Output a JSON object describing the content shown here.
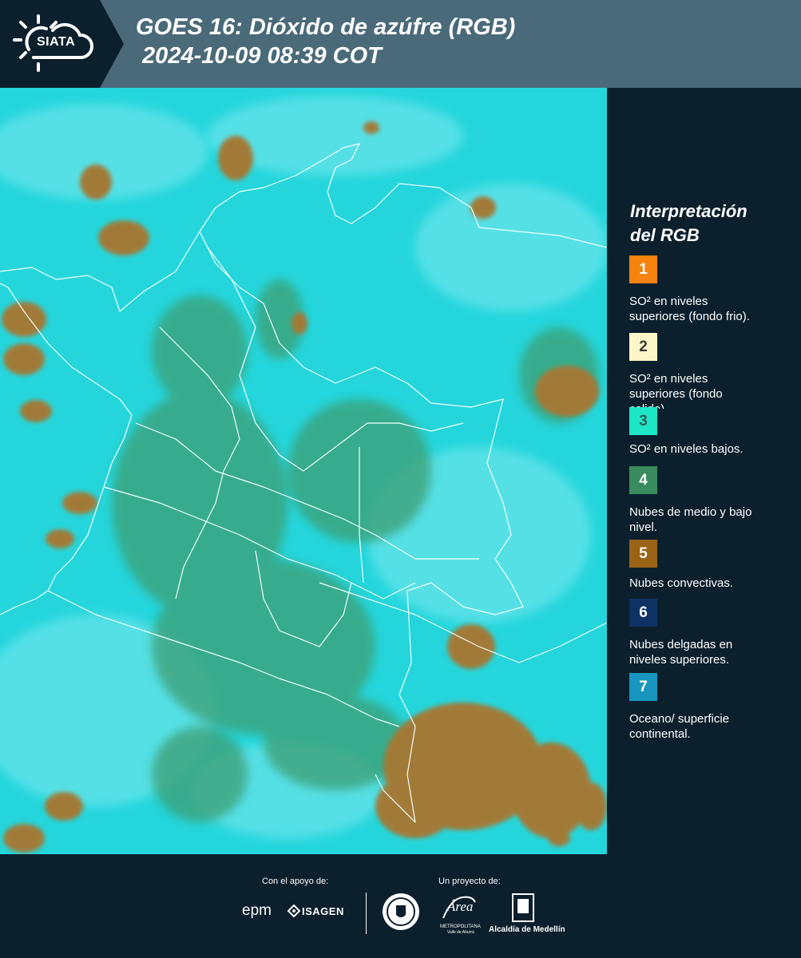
{
  "header": {
    "brand": "SIATA",
    "title_line1": "GOES 16: Dióxido de azúfre (RGB)",
    "title_line2": " 2024-10-09 08:39 COT"
  },
  "legend": {
    "title_line1": "Interpretación",
    "title_line2": "del RGB",
    "items": [
      {
        "number": "1",
        "color": "#f5830e",
        "desc_line1": "SO² en niveles",
        "desc_line2": "superiores (fondo frio)."
      },
      {
        "number": "2",
        "color": "#fdf6c8",
        "desc_line1": "SO² en niveles",
        "desc_line2": "superiores (fondo",
        "desc_line3": "calido)."
      },
      {
        "number": "3",
        "color": "#1de6c6",
        "desc_line1": "SO² en niveles bajos."
      },
      {
        "number": "4",
        "color": "#3a8c5e",
        "desc_line1": "Nubes de medio y bajo",
        "desc_line2": "nivel."
      },
      {
        "number": "5",
        "color": "#9a6315",
        "desc_line1": "Nubes convectivas."
      },
      {
        "number": "6",
        "color": "#0f3265",
        "desc_line1": "Nubes delgadas en",
        "desc_line2": "niveles superiores."
      },
      {
        "number": "7",
        "color": "#1896c0",
        "desc_line1": "Oceano/ superficie",
        "desc_line2": "continental."
      }
    ]
  },
  "footer": {
    "support_label": "Con el apoyo de:",
    "project_label": "Un proyecto de:",
    "logo_epm": "epm",
    "logo_isagen": "ISAGEN",
    "logo_area_line1": "Área",
    "logo_area_line2": "METROPOLITANA",
    "logo_area_line3": "Valle de Aburrá",
    "logo_alcaldia": "Alcaldía de Medellín"
  },
  "colors": {
    "background": "#0b1f2d",
    "header_bar": "#4a6a79",
    "map_cyan": "#24d6dc",
    "map_green": "#3c9e72",
    "map_brown": "#a27a37"
  }
}
